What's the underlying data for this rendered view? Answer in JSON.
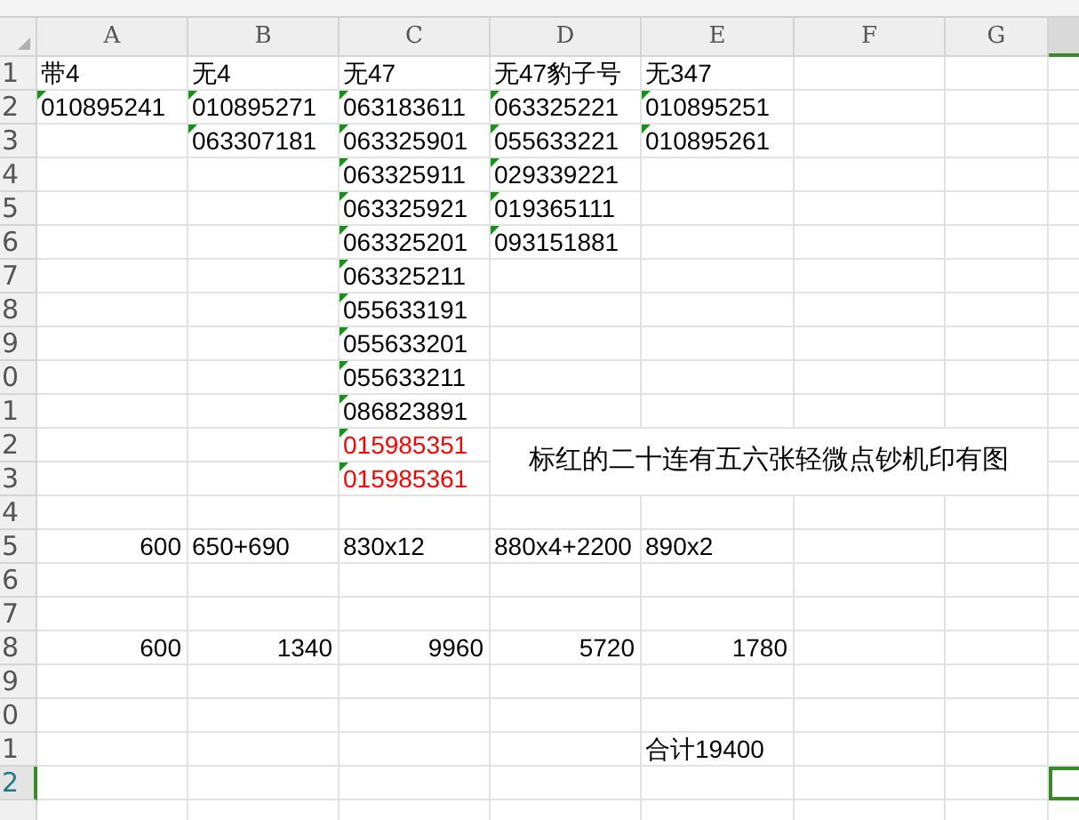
{
  "columns": [
    {
      "label": "A",
      "selected": false
    },
    {
      "label": "B",
      "selected": false
    },
    {
      "label": "C",
      "selected": false
    },
    {
      "label": "D",
      "selected": false
    },
    {
      "label": "E",
      "selected": false
    },
    {
      "label": "F",
      "selected": false
    },
    {
      "label": "G",
      "selected": false
    }
  ],
  "partial_column": {
    "selected": true
  },
  "rows": [
    {
      "header": "1",
      "selected": false,
      "cells": {
        "A": {
          "text": "带4",
          "kind": "text",
          "flagged": false
        },
        "B": {
          "text": "无4",
          "kind": "text",
          "flagged": false
        },
        "C": {
          "text": "无47",
          "kind": "text",
          "flagged": false
        },
        "D": {
          "text": "无47豹子号",
          "kind": "text",
          "flagged": false
        },
        "E": {
          "text": "无347",
          "kind": "text",
          "flagged": false
        }
      }
    },
    {
      "header": "2",
      "selected": false,
      "cells": {
        "A": {
          "text": "010895241",
          "kind": "text",
          "flagged": true
        },
        "B": {
          "text": "010895271",
          "kind": "text",
          "flagged": true
        },
        "C": {
          "text": "063183611",
          "kind": "text",
          "flagged": true
        },
        "D": {
          "text": "063325221",
          "kind": "text",
          "flagged": true
        },
        "E": {
          "text": "010895251",
          "kind": "text",
          "flagged": true
        }
      }
    },
    {
      "header": "3",
      "selected": false,
      "cells": {
        "B": {
          "text": "063307181",
          "kind": "text",
          "flagged": true
        },
        "C": {
          "text": "063325901",
          "kind": "text",
          "flagged": true
        },
        "D": {
          "text": "055633221",
          "kind": "text",
          "flagged": true
        },
        "E": {
          "text": "010895261",
          "kind": "text",
          "flagged": true
        }
      }
    },
    {
      "header": "4",
      "selected": false,
      "cells": {
        "C": {
          "text": "063325911",
          "kind": "text",
          "flagged": true
        },
        "D": {
          "text": "029339221",
          "kind": "text",
          "flagged": true
        }
      }
    },
    {
      "header": "5",
      "selected": false,
      "cells": {
        "C": {
          "text": "063325921",
          "kind": "text",
          "flagged": true
        },
        "D": {
          "text": "019365111",
          "kind": "text",
          "flagged": true
        }
      }
    },
    {
      "header": "6",
      "selected": false,
      "cells": {
        "C": {
          "text": "063325201",
          "kind": "text",
          "flagged": true
        },
        "D": {
          "text": "093151881",
          "kind": "text",
          "flagged": true
        }
      }
    },
    {
      "header": "7",
      "selected": false,
      "cells": {
        "C": {
          "text": "063325211",
          "kind": "text",
          "flagged": true
        }
      }
    },
    {
      "header": "8",
      "selected": false,
      "cells": {
        "C": {
          "text": "055633191",
          "kind": "text",
          "flagged": true
        }
      }
    },
    {
      "header": "9",
      "selected": false,
      "cells": {
        "C": {
          "text": "055633201",
          "kind": "text",
          "flagged": true
        }
      }
    },
    {
      "header": "0",
      "selected": false,
      "cells": {
        "C": {
          "text": "055633211",
          "kind": "text",
          "flagged": true
        }
      }
    },
    {
      "header": "1",
      "selected": false,
      "cells": {
        "C": {
          "text": "086823891",
          "kind": "text",
          "flagged": true
        }
      }
    },
    {
      "header": "2",
      "selected": false,
      "cells": {
        "C": {
          "text": "015985351",
          "kind": "text",
          "flagged": true,
          "color": "#ff0000"
        }
      }
    },
    {
      "header": "3",
      "selected": false,
      "cells": {
        "C": {
          "text": "015985361",
          "kind": "text",
          "flagged": true,
          "color": "#ff0000"
        }
      }
    },
    {
      "header": "4",
      "selected": false,
      "cells": {}
    },
    {
      "header": "5",
      "selected": false,
      "cells": {
        "A": {
          "text": "600",
          "kind": "number",
          "flagged": false
        },
        "B": {
          "text": "650+690",
          "kind": "text",
          "flagged": false
        },
        "C": {
          "text": "830x12",
          "kind": "text",
          "flagged": false
        },
        "D": {
          "text": "880x4+2200",
          "kind": "text",
          "flagged": false
        },
        "E": {
          "text": "890x2",
          "kind": "text",
          "flagged": false
        }
      }
    },
    {
      "header": "6",
      "selected": false,
      "cells": {}
    },
    {
      "header": "7",
      "selected": false,
      "cells": {}
    },
    {
      "header": "8",
      "selected": false,
      "cells": {
        "A": {
          "text": "600",
          "kind": "number",
          "flagged": false
        },
        "B": {
          "text": "1340",
          "kind": "number",
          "flagged": false
        },
        "C": {
          "text": "9960",
          "kind": "number",
          "flagged": false
        },
        "D": {
          "text": "5720",
          "kind": "number",
          "flagged": false
        },
        "E": {
          "text": "1780",
          "kind": "number",
          "flagged": false
        }
      }
    },
    {
      "header": "9",
      "selected": false,
      "cells": {}
    },
    {
      "header": "0",
      "selected": false,
      "cells": {}
    },
    {
      "header": "1",
      "selected": false,
      "cells": {
        "E": {
          "text": "合计19400",
          "kind": "text",
          "flagged": false
        }
      }
    },
    {
      "header": "2",
      "selected": true,
      "cells": {}
    }
  ],
  "note": {
    "text": "标红的二十连有五六张轻微点钞机印有图"
  }
}
